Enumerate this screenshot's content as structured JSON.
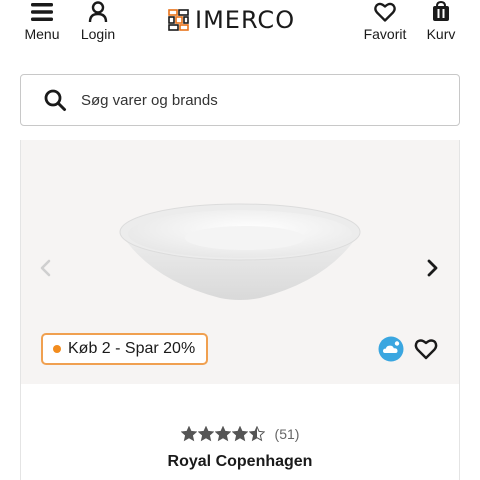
{
  "header": {
    "menu_label": "Menu",
    "login_label": "Login",
    "logo_text": "IMERCO",
    "favorites_label": "Favorit",
    "cart_label": "Kurv"
  },
  "search": {
    "placeholder": "Søg varer og brands"
  },
  "product": {
    "badge_text": "Køb 2 - Spar 20%",
    "rating_value": 4.5,
    "rating_max": 5,
    "review_count": "(51)",
    "brand": "Royal Copenhagen"
  },
  "colors": {
    "badge_border": "#f0a050",
    "badge_dot": "#f28c1e",
    "image_bg": "#f6f4f3",
    "star_color": "#555555",
    "cloud_icon": "#3aa6e0"
  },
  "icons": {
    "menu": "hamburger-icon",
    "login": "user-icon",
    "favorites": "heart-icon",
    "cart": "basket-icon",
    "search": "search-icon",
    "prev": "chevron-left-icon",
    "next": "chevron-right-icon",
    "climate": "cloud-icon",
    "wishlist": "heart-icon"
  }
}
